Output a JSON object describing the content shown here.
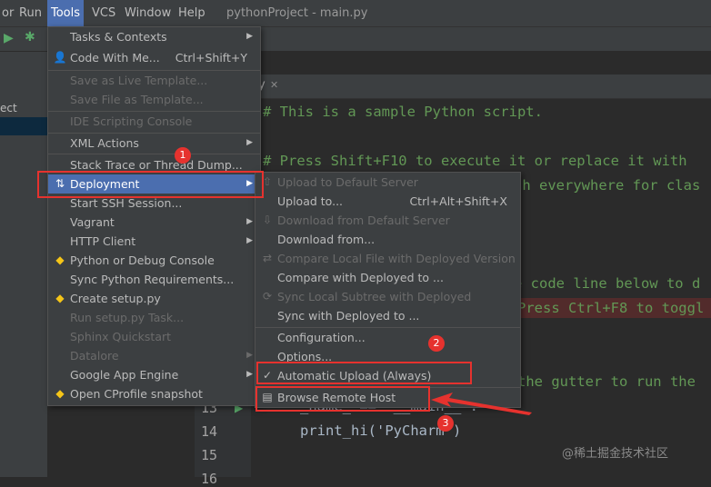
{
  "menubar": {
    "items": [
      "Run",
      "Tools",
      "VCS",
      "Window",
      "Help"
    ],
    "partial_left": "or",
    "title": "pythonProject - main.py"
  },
  "project_panel": {
    "partial_label": "ect"
  },
  "editor": {
    "tab_close": "✕",
    "tab_partial": "y",
    "lines": [
      {
        "text": "# This is a sample Python script.",
        "cls": "comment"
      },
      {
        "text": "# Press Shift+F10 to execute it or replace it with",
        "cls": "comment"
      },
      {
        "text": "ch everywhere for clas",
        "cls": "comment"
      },
      {
        "text": "e code line below to d",
        "cls": "comment"
      },
      {
        "text": "Press Ctrl+F8 to toggl",
        "cls": "comment"
      },
      {
        "text": "the gutter to run the",
        "cls": "comment"
      },
      {
        "text": "_name_ == '__main__':",
        "cls": "code"
      },
      {
        "text": "print_hi('PyCharm')",
        "cls": "code"
      }
    ],
    "line_numbers": [
      "13",
      "14",
      "15",
      "16"
    ]
  },
  "tools_menu": {
    "items": [
      {
        "label": "Tasks & Contexts",
        "submenu": true,
        "enabled": true
      },
      {
        "label": "Code With Me...",
        "shortcut": "Ctrl+Shift+Y",
        "enabled": true,
        "icon": "user-icon"
      },
      {
        "label": "Save as Live Template...",
        "enabled": false
      },
      {
        "label": "Save File as Template...",
        "enabled": false
      },
      {
        "label": "IDE Scripting Console",
        "enabled": false
      },
      {
        "label": "XML Actions",
        "submenu": true,
        "enabled": true
      },
      {
        "label": "Stack Trace or Thread Dump...",
        "enabled": true
      },
      {
        "label": "Deployment",
        "submenu": true,
        "enabled": true,
        "selected": true,
        "icon": "deployment-icon"
      },
      {
        "label": "Start SSH Session...",
        "enabled": true
      },
      {
        "label": "Vagrant",
        "submenu": true,
        "enabled": true
      },
      {
        "label": "HTTP Client",
        "submenu": true,
        "enabled": true
      },
      {
        "label": "Python or Debug Console",
        "enabled": true,
        "icon": "python-icon"
      },
      {
        "label": "Sync Python Requirements...",
        "enabled": true
      },
      {
        "label": "Create setup.py",
        "enabled": true,
        "icon": "python-icon"
      },
      {
        "label": "Run setup.py Task...",
        "enabled": false
      },
      {
        "label": "Sphinx Quickstart",
        "enabled": false
      },
      {
        "label": "Datalore",
        "submenu": true,
        "enabled": false
      },
      {
        "label": "Google App Engine",
        "submenu": true,
        "enabled": true
      },
      {
        "label": "Open CProfile snapshot",
        "enabled": true,
        "icon": "python-icon"
      }
    ]
  },
  "deployment_menu": {
    "items": [
      {
        "label": "Upload to Default Server",
        "enabled": false,
        "icon": "upload-icon"
      },
      {
        "label": "Upload to...",
        "shortcut": "Ctrl+Alt+Shift+X",
        "enabled": true
      },
      {
        "label": "Download from Default Server",
        "enabled": false,
        "icon": "download-icon"
      },
      {
        "label": "Download from...",
        "enabled": true
      },
      {
        "label": "Compare Local File with Deployed Version",
        "enabled": false,
        "icon": "compare-icon"
      },
      {
        "label": "Compare with Deployed to ...",
        "enabled": true
      },
      {
        "label": "Sync Local Subtree with Deployed",
        "enabled": false,
        "icon": "sync-icon"
      },
      {
        "label": "Sync with Deployed to ...",
        "enabled": true
      },
      {
        "label": "Configuration...",
        "enabled": true
      },
      {
        "label": "Options...",
        "enabled": true
      },
      {
        "label": "Automatic Upload (Always)",
        "enabled": true,
        "checked": true
      },
      {
        "label": "Browse Remote Host",
        "enabled": true,
        "icon": "remote-host-icon"
      }
    ]
  },
  "annotations": {
    "badge1": "1",
    "badge2": "2",
    "badge3": "3"
  },
  "watermark": "@稀土掘金技术社区",
  "colors": {
    "menu_bg": "#3c3f41",
    "selection": "#4b6eaf",
    "highlight_red": "#e6322e",
    "comment": "#629755",
    "keyword": "#cc7832",
    "string": "#6a8759"
  }
}
